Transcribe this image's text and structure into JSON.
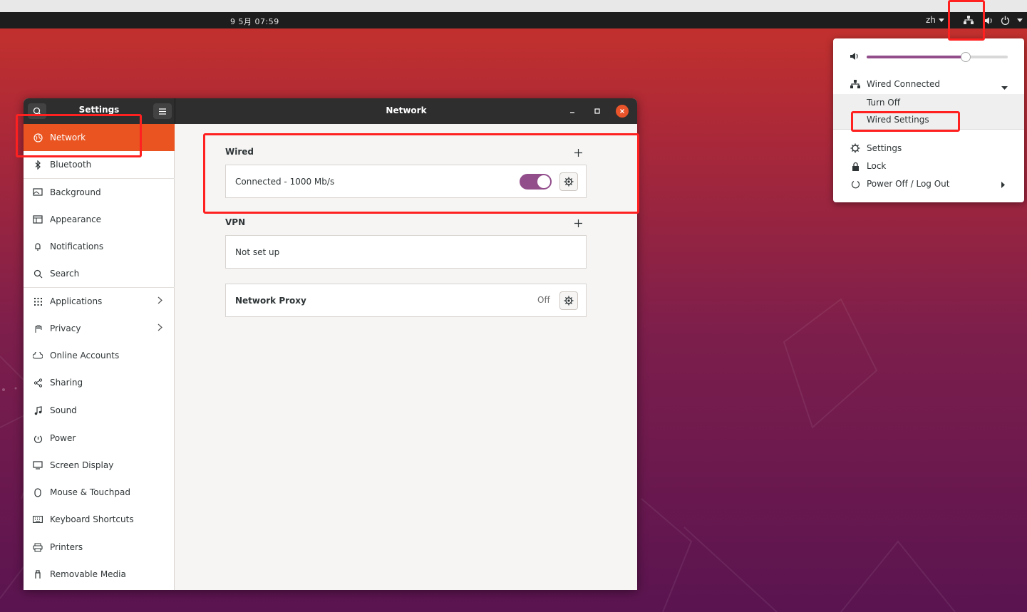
{
  "topbar": {
    "clock": "9 5月  07:59",
    "language": "zh"
  },
  "window": {
    "sidebar_title": "Settings",
    "page_title": "Network"
  },
  "sidebar": {
    "items": [
      {
        "label": "Network",
        "icon": "network-icon",
        "active": true
      },
      {
        "label": "Bluetooth",
        "icon": "bluetooth-icon"
      },
      {
        "label": "Background",
        "icon": "background-icon"
      },
      {
        "label": "Appearance",
        "icon": "appearance-icon"
      },
      {
        "label": "Notifications",
        "icon": "bell-icon"
      },
      {
        "label": "Search",
        "icon": "search-icon"
      },
      {
        "label": "Applications",
        "icon": "grid-icon",
        "submenu": true
      },
      {
        "label": "Privacy",
        "icon": "hand-icon",
        "submenu": true
      },
      {
        "label": "Online Accounts",
        "icon": "cloud-icon"
      },
      {
        "label": "Sharing",
        "icon": "share-icon"
      },
      {
        "label": "Sound",
        "icon": "music-note-icon"
      },
      {
        "label": "Power",
        "icon": "power-icon"
      },
      {
        "label": "Screen Display",
        "icon": "display-icon"
      },
      {
        "label": "Mouse & Touchpad",
        "icon": "mouse-icon"
      },
      {
        "label": "Keyboard Shortcuts",
        "icon": "keyboard-icon"
      },
      {
        "label": "Printers",
        "icon": "printer-icon"
      },
      {
        "label": "Removable Media",
        "icon": "usb-drive-icon"
      }
    ]
  },
  "network": {
    "wired": {
      "title": "Wired",
      "status": "Connected - 1000 Mb/s",
      "enabled": true
    },
    "vpn": {
      "title": "VPN",
      "status": "Not set up"
    },
    "proxy": {
      "title": "Network Proxy",
      "status": "Off"
    }
  },
  "popup_menu": {
    "volume_level": 0.7,
    "wired_label": "Wired Connected",
    "turn_off": "Turn Off",
    "wired_settings": "Wired Settings",
    "settings": "Settings",
    "lock": "Lock",
    "power_off": "Power Off / Log Out"
  },
  "colors": {
    "accent": "#e95420",
    "toggle": "#924d8b",
    "highlight_box": "#ff2020",
    "headerbar": "#2e2e2e"
  }
}
